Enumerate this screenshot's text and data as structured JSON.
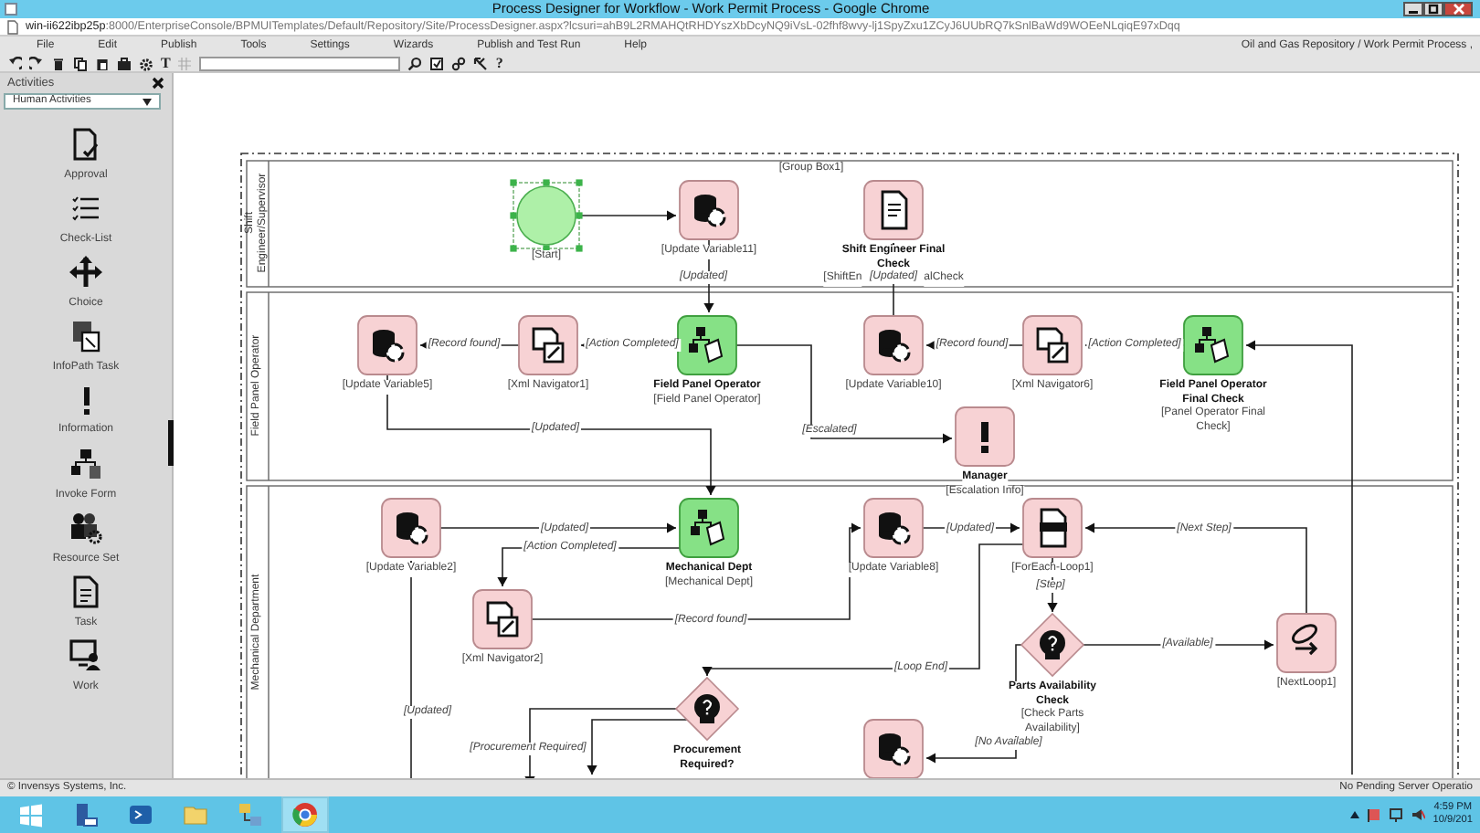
{
  "window": {
    "title": "Process Designer for Workflow - Work Permit Process - Google Chrome"
  },
  "address_bar": {
    "host": "win-ii622ibp25p",
    "path": ":8000/EnterpriseConsole/BPMUITemplates/Default/Repository/Site/ProcessDesigner.aspx?lcsuri=ahB9L2RMAHQtRHDYszXbDcyNQ9iVsL-02fhf8wvy-lj1SpyZxu1ZCyJ6UUbRQ7kSnlBaWd9WOEeNLqiqE97xDqq"
  },
  "menu": [
    "File",
    "Edit",
    "Publish",
    "Tools",
    "Settings",
    "Wizards",
    "Publish and Test Run",
    "Help"
  ],
  "breadcrumb": "Oil and Gas Repository / Work Permit Process ,",
  "toolbar": {
    "text_tools": [
      "T",
      "?"
    ]
  },
  "activities": {
    "title": "Activities",
    "category": "Human Activities",
    "items": [
      {
        "label": "Approval"
      },
      {
        "label": "Check-List"
      },
      {
        "label": "Choice"
      },
      {
        "label": "InfoPath Task"
      },
      {
        "label": "Information"
      },
      {
        "label": "Invoke Form"
      },
      {
        "label": "Resource Set"
      },
      {
        "label": "Task"
      },
      {
        "label": "Work"
      }
    ]
  },
  "diagram": {
    "group_title": "[Group Box1]",
    "lanes": [
      {
        "title": "Shift Engineer/Supervisor"
      },
      {
        "title": "Field Panel Operator"
      },
      {
        "title": "Mechanical Department"
      }
    ],
    "nodes": [
      {
        "kind": "start",
        "caption": "[Start]",
        "selected": true
      },
      {
        "kind": "update_variable",
        "caption": "[Update Variable11]"
      },
      {
        "kind": "form",
        "title": "Shift Engineer Final Check",
        "caption": [
          "[ShiftEn",
          "alCheck"
        ]
      },
      {
        "kind": "update_variable",
        "caption": "[Update Variable5]"
      },
      {
        "kind": "xml_navigator",
        "caption": "[Xml Navigator1]"
      },
      {
        "kind": "human",
        "title": "Field Panel Operator",
        "caption": "[Field Panel Operator]"
      },
      {
        "kind": "update_variable",
        "caption": "[Update Variable10]"
      },
      {
        "kind": "xml_navigator",
        "caption": "[Xml Navigator6]"
      },
      {
        "kind": "human",
        "title": "Field Panel Operator Final Check",
        "caption": "[Panel Operator Final Check]"
      },
      {
        "kind": "info",
        "title": "Manager",
        "caption": "[Escalation Info]"
      },
      {
        "kind": "update_variable",
        "caption": "[Update Variable2]"
      },
      {
        "kind": "human",
        "title": "Mechanical Dept",
        "caption": "[Mechanical Dept]"
      },
      {
        "kind": "xml_navigator",
        "caption": "[Xml Navigator2]"
      },
      {
        "kind": "update_variable",
        "caption": "[Update Variable8]"
      },
      {
        "kind": "loop",
        "caption": "[ForEach-Loop1]"
      },
      {
        "kind": "decision",
        "title": "Parts Availability Check",
        "caption": "[Check Parts Availability]"
      },
      {
        "kind": "next",
        "caption": "[NextLoop1]"
      },
      {
        "kind": "decision",
        "title": "Procurement Required?"
      },
      {
        "kind": "update_variable"
      }
    ],
    "edges": [
      {
        "arrow": true
      },
      {
        "label": "[Updated]",
        "arrow": true
      },
      {
        "label": "[Updated]",
        "arrow": true
      },
      {
        "label": "[Record found]",
        "arrow": true
      },
      {
        "label": "[Action Completed]",
        "arrow": true
      },
      {
        "label": "[Record found]",
        "arrow": true
      },
      {
        "label": "[Action Completed]",
        "arrow": true
      },
      {
        "label": "[Updated]",
        "arrow": true
      },
      {
        "label": "[Escalated]",
        "arrow": true
      },
      {
        "label": "[Updated]",
        "arrow": true
      },
      {
        "label": "[Action Completed]",
        "arrow": true
      },
      {
        "label": "[Record found]",
        "arrow": true
      },
      {
        "label": "[Updated]",
        "arrow": true
      },
      {
        "label": "[Next Step]",
        "arrow": true
      },
      {
        "label": "[Step]",
        "arrow": true
      },
      {
        "label": "[Loop End]",
        "arrow": true
      },
      {
        "label": "[Available]",
        "arrow": true
      },
      {
        "label": "[No Available]",
        "arrow": true
      },
      {
        "label": "[Updated]",
        "arrow": true
      },
      {
        "label": "[Procurement Required]",
        "arrow": true
      },
      {
        "arrow": true
      },
      {
        "arrow": true
      }
    ]
  },
  "status_bar": {
    "left": "© Invensys Systems, Inc.",
    "right": "No Pending Server Operatio"
  },
  "taskbar": {
    "apps": [
      {
        "selected": false
      },
      {
        "selected": false
      },
      {
        "selected": false
      },
      {
        "selected": false
      },
      {
        "selected": false
      },
      {
        "selected": true
      }
    ],
    "time": "4:59 PM",
    "date": "10/9/201"
  }
}
